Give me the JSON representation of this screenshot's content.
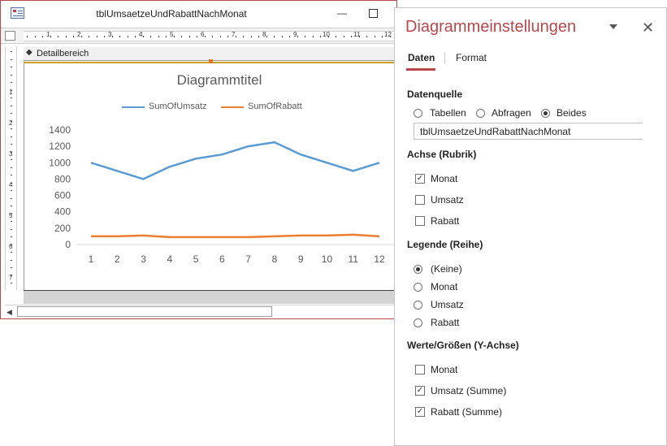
{
  "window": {
    "title": "tblUmsaetzeUndRabattNachMonat",
    "minimize": "—"
  },
  "ruler": {
    "h_labels": [
      "1",
      "2",
      "3",
      "4",
      "5",
      "6",
      "7",
      "8",
      "9",
      "10",
      "11",
      "12"
    ],
    "v_labels": [
      "1",
      "2",
      "3",
      "4",
      "5",
      "6",
      "7"
    ]
  },
  "section": {
    "label": "Detailbereich",
    "arrow": "◆"
  },
  "chart_data": {
    "type": "line",
    "title": "Diagrammtitel",
    "categories": [
      1,
      2,
      3,
      4,
      5,
      6,
      7,
      8,
      9,
      10,
      11,
      12
    ],
    "series": [
      {
        "name": "SumOfUmsatz",
        "color": "#5b9bd5",
        "values": [
          1000,
          900,
          800,
          950,
          1050,
          1100,
          1200,
          1250,
          1100,
          1000,
          900,
          1000
        ]
      },
      {
        "name": "SumOfRabatt",
        "color": "#ed7d31",
        "values": [
          100,
          100,
          110,
          90,
          90,
          90,
          90,
          100,
          110,
          110,
          120,
          100
        ]
      }
    ],
    "y_ticks": [
      "1400",
      "1200",
      "1000",
      "800",
      "600",
      "400",
      "200",
      "0"
    ],
    "ylim": [
      0,
      1400
    ],
    "grid": false,
    "legend_position": "top"
  },
  "pane": {
    "title": "Diagrammeinstellungen",
    "close": "✕",
    "tabs": {
      "data": "Daten",
      "format": "Format"
    },
    "datasource": {
      "heading": "Datenquelle",
      "options": [
        {
          "label": "Tabellen",
          "selected": false
        },
        {
          "label": "Abfragen",
          "selected": false
        },
        {
          "label": "Beides",
          "selected": true
        }
      ],
      "value": "tblUmsaetzeUndRabattNachMonat"
    },
    "axis": {
      "heading": "Achse (Rubrik)",
      "items": [
        {
          "label": "Monat",
          "checked": true,
          "mark": "✓"
        },
        {
          "label": "Umsatz",
          "checked": false,
          "mark": ""
        },
        {
          "label": "Rabatt",
          "checked": false,
          "mark": ""
        }
      ]
    },
    "legend": {
      "heading": "Legende (Reihe)",
      "items": [
        {
          "label": "(Keine)",
          "selected": true
        },
        {
          "label": "Monat",
          "selected": false
        },
        {
          "label": "Umsatz",
          "selected": false
        },
        {
          "label": "Rabatt",
          "selected": false
        }
      ]
    },
    "values": {
      "heading": "Werte/Größen (Y-Achse)",
      "items": [
        {
          "label": "Monat",
          "checked": false,
          "mark": ""
        },
        {
          "label": "Umsatz (Summe)",
          "checked": true,
          "mark": "✓"
        },
        {
          "label": "Rabatt (Summe)",
          "checked": true,
          "mark": "✓"
        }
      ]
    }
  }
}
